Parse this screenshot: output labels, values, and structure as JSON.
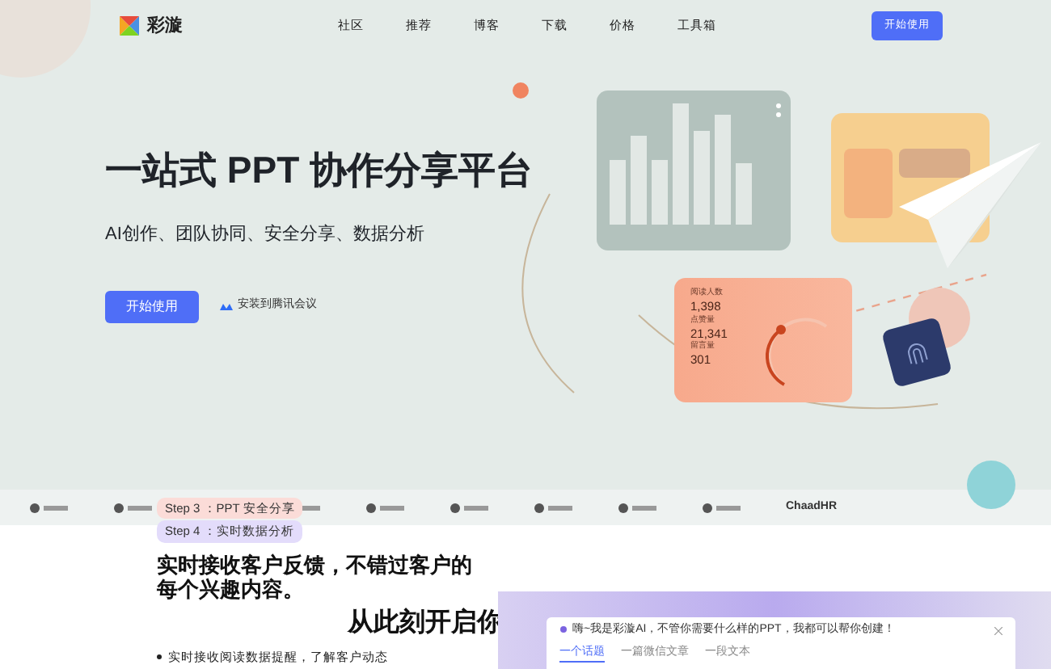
{
  "brand": {
    "name": "彩漩"
  },
  "nav": [
    {
      "label": "社区"
    },
    {
      "label": "推荐"
    },
    {
      "label": "博客"
    },
    {
      "label": "下载"
    },
    {
      "label": "价格"
    },
    {
      "label": "工具箱"
    }
  ],
  "header_button": "开始使用",
  "hero": {
    "title": "一站式 PPT 协作分享平台",
    "subtitle": "AI创作、团队协同、安全分享、数据分析",
    "primary_button": "开始使用",
    "secondary_link": "安装到腾讯会议"
  },
  "stats_card": {
    "items": [
      {
        "label": "阅读人数",
        "value": "1,398"
      },
      {
        "label": "点赞量",
        "value": "21,341"
      },
      {
        "label": "留言量",
        "value": "301"
      }
    ]
  },
  "partners": [
    {
      "name": "ChaadHR"
    }
  ],
  "steps": [
    {
      "label": "Step 3 ：PPT 安全分享",
      "color": "#fbdcd8"
    },
    {
      "label": "Step 4 ：实时数据分析",
      "color": "#e3dcfb"
    }
  ],
  "section": {
    "paragraph": "实时接收客户反馈，不错过客户的每个兴趣内容。",
    "heading": "从此刻开启你",
    "bullets": [
      "实时接收阅读数据提醒，了解客户动态"
    ]
  },
  "ai_dialog": {
    "prompt": "嗨~我是彩漩AI，不管你需要什么样的PPT，我都可以帮你创建！",
    "tabs": [
      {
        "label": "一个话题",
        "selected": true
      },
      {
        "label": "一篇微信文章",
        "selected": false
      },
      {
        "label": "一段文本",
        "selected": false
      }
    ]
  }
}
